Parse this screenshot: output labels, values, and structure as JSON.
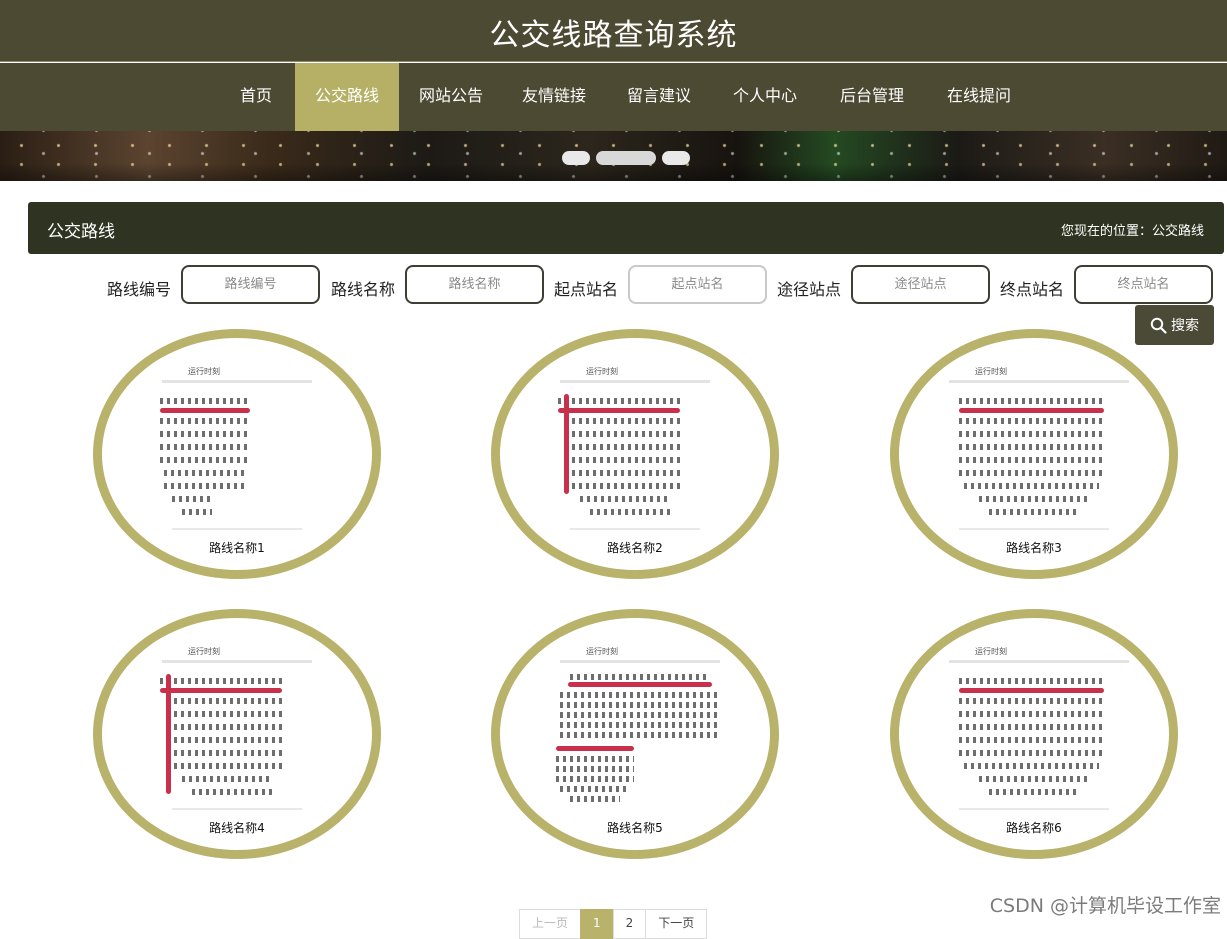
{
  "site_title": "公交线路查询系统",
  "nav": {
    "items": [
      "首页",
      "公交路线",
      "网站公告",
      "友情链接",
      "留言建议",
      "个人中心",
      "后台管理",
      "在线提问"
    ],
    "active": "公交路线"
  },
  "section": {
    "title": "公交路线",
    "breadcrumb": "您现在的位置：公交路线"
  },
  "filters": [
    {
      "label": "路线编号",
      "placeholder": "路线编号"
    },
    {
      "label": "路线名称",
      "placeholder": "路线名称"
    },
    {
      "label": "起点站名",
      "placeholder": "起点站名"
    },
    {
      "label": "途径站点",
      "placeholder": "途径站点"
    },
    {
      "label": "终点站名",
      "placeholder": "终点站名"
    }
  ],
  "search_button": "搜索",
  "routes": [
    {
      "name": "路线名称1"
    },
    {
      "name": "路线名称2"
    },
    {
      "name": "路线名称3"
    },
    {
      "name": "路线名称4"
    },
    {
      "name": "路线名称5"
    },
    {
      "name": "路线名称6"
    }
  ],
  "pagination": {
    "prev": "上一页",
    "pages": [
      "1",
      "2"
    ],
    "current": "1",
    "next": "下一页"
  },
  "watermark": "CSDN @计算机毕设工作室",
  "colors": {
    "header_bg": "#4d4a33",
    "nav_active": "#b5b065",
    "section_bar": "#2f3321",
    "ring": "#b8b26a",
    "timetable_red": "#c8304c"
  }
}
